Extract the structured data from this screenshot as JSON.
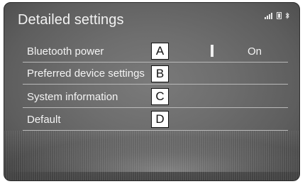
{
  "screen": {
    "title": "Detailed settings"
  },
  "status_icons": [
    "signal-icon",
    "phone-battery-icon",
    "bluetooth-icon"
  ],
  "settings": [
    {
      "label": "Bluetooth power",
      "value": "On",
      "callout": "A"
    },
    {
      "label": "Preferred device settings",
      "value": "",
      "callout": "B"
    },
    {
      "label": "System information",
      "value": "",
      "callout": "C"
    },
    {
      "label": "Default",
      "value": "",
      "callout": "D"
    }
  ]
}
